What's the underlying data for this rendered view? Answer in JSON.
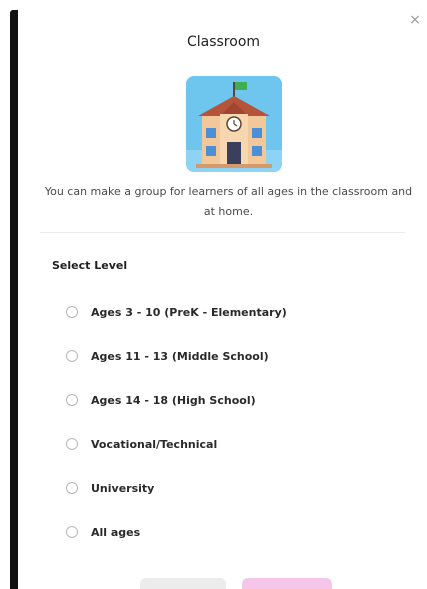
{
  "dialog": {
    "title": "Classroom",
    "description": "You can make a group for learners of all ages in the classroom and at home.",
    "illustration_icon": "school-building-icon",
    "close_icon": "×"
  },
  "level": {
    "label": "Select Level",
    "options": [
      {
        "label": "Ages 3 - 10 (PreK - Elementary)",
        "selected": false
      },
      {
        "label": "Ages 11 - 13 (Middle School)",
        "selected": false
      },
      {
        "label": "Ages 14 - 18 (High School)",
        "selected": false
      },
      {
        "label": "Vocational/Technical",
        "selected": false
      },
      {
        "label": "University",
        "selected": false
      },
      {
        "label": "All ages",
        "selected": false
      }
    ]
  },
  "colors": {
    "primary_button": "#f6c5ea",
    "secondary_button": "#ececec",
    "illustration_bg": "#6ec6ef"
  }
}
